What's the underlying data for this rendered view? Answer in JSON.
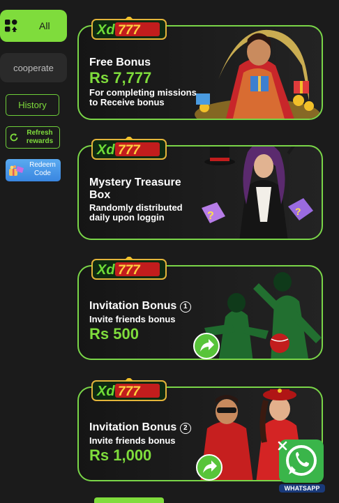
{
  "sidebar": {
    "tabs": [
      {
        "label": "All",
        "icon": "category-grid-icon",
        "active": true
      },
      {
        "label": "cooperate",
        "active": false
      }
    ],
    "history_label": "History",
    "refresh_label": "Refresh rewards",
    "redeem_label": "Redeem Code"
  },
  "brand": {
    "logo_text": "Xd777",
    "accent": "#7fdc3c",
    "card_border": "#7ad648"
  },
  "cards": [
    {
      "title": "Free Bonus",
      "amount": "Rs 7,777",
      "subtitle": "For completing missions to Receive bonus",
      "art": "woman-with-gift-and-coins"
    },
    {
      "title": "Mystery Treasure Box",
      "subtitle": "Randomly distributed daily upon loggin",
      "art": "magician-woman-with-mystery-boxes"
    },
    {
      "title": "Invitation Bonus",
      "badge": "1",
      "subtitle": "Invite friends bonus",
      "amount": "Rs 500",
      "art": "cricket-players"
    },
    {
      "title": "Invitation Bonus",
      "badge": "2",
      "subtitle": "Invite friends bonus",
      "amount": "Rs 1,000",
      "art": "pilots-couple"
    }
  ],
  "whatsapp": {
    "label": "WHATSAPP",
    "icon": "whatsapp-icon",
    "close_icon": "close-icon"
  }
}
